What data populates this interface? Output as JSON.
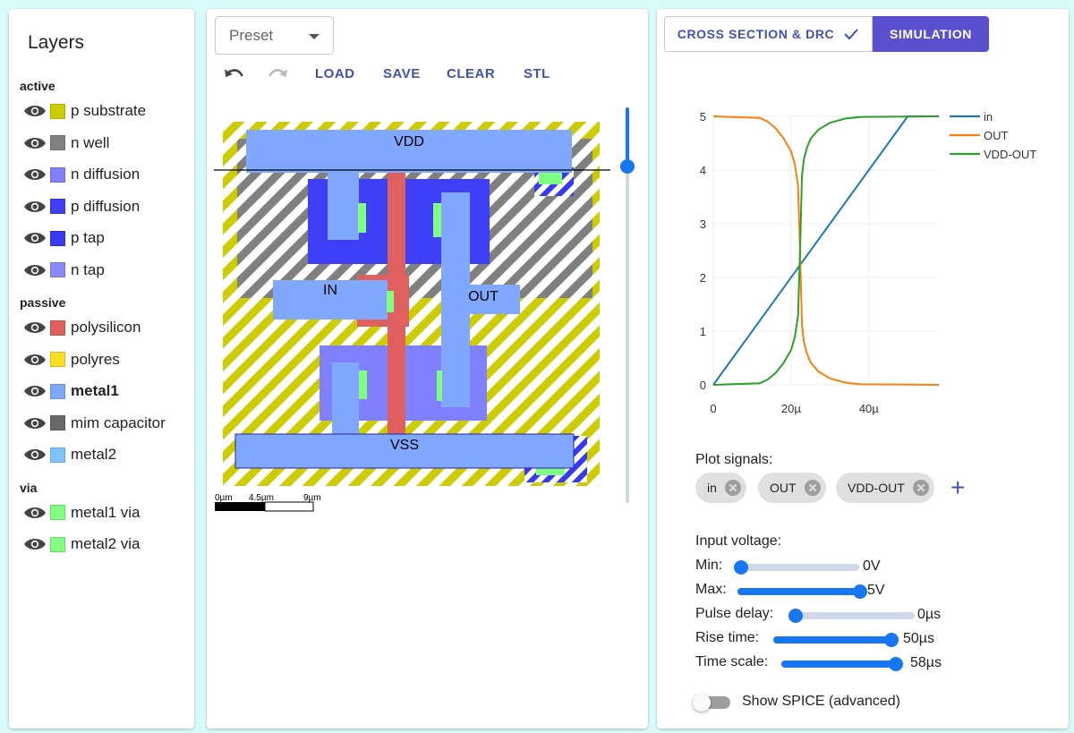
{
  "layers": {
    "title": "Layers",
    "groups": [
      {
        "label": "active",
        "items": [
          {
            "name": "p substrate",
            "color": "#cccc00",
            "bold": false
          },
          {
            "name": "n well",
            "color": "#808080",
            "bold": false
          },
          {
            "name": "n diffusion",
            "color": "#8080ff",
            "bold": false
          },
          {
            "name": "p diffusion",
            "color": "#3f3ff8",
            "bold": false
          },
          {
            "name": "p tap",
            "color": "#3838f0",
            "bold": false
          },
          {
            "name": "n tap",
            "color": "#8888ff",
            "bold": false
          }
        ]
      },
      {
        "label": "passive",
        "items": [
          {
            "name": "polysilicon",
            "color": "#e06060",
            "bold": false
          },
          {
            "name": "polyres",
            "color": "#ffdd22",
            "bold": false
          },
          {
            "name": "metal1",
            "color": "#80a8ff",
            "bold": true
          },
          {
            "name": "mim capacitor",
            "color": "#686868",
            "bold": false
          },
          {
            "name": "metal2",
            "color": "#80c4ff",
            "bold": false
          }
        ]
      },
      {
        "label": "via",
        "items": [
          {
            "name": "metal1 via",
            "color": "#80ff80",
            "bold": false
          },
          {
            "name": "metal2 via",
            "color": "#80ff80",
            "bold": false
          }
        ]
      }
    ]
  },
  "layout": {
    "preset_label": "Preset",
    "toolbar": {
      "load": "LOAD",
      "save": "SAVE",
      "clear": "CLEAR",
      "stl": "STL"
    },
    "net_labels": {
      "vdd": "VDD",
      "vss": "VSS",
      "in": "IN",
      "out": "OUT"
    },
    "scale_labels": [
      "0µm",
      "4.5µm",
      "9µm"
    ]
  },
  "sim": {
    "tab_cross_section": "CROSS SECTION & DRC",
    "tab_simulation": "SIMULATION",
    "plot_signals_label": "Plot signals:",
    "signals": [
      "in",
      "OUT",
      "VDD-OUT"
    ],
    "input_voltage_label": "Input voltage:",
    "sliders": [
      {
        "label": "Min:",
        "value": "0V",
        "fraction": 0.02
      },
      {
        "label": "Max:",
        "value": "5V",
        "fraction": 0.98
      },
      {
        "label": "Pulse delay:",
        "value": "0µs",
        "fraction": 0.02
      },
      {
        "label": "Rise time:",
        "value": "50µs",
        "fraction": 0.98
      },
      {
        "label": "Time scale:",
        "value": "58µs",
        "fraction": 0.98
      }
    ],
    "show_spice_label": "Show SPICE (advanced)"
  },
  "chart_data": {
    "type": "line",
    "x_tick_labels": [
      "0",
      "20µ",
      "40µ"
    ],
    "x_ticks": [
      0,
      20,
      40
    ],
    "y_ticks": [
      0,
      1,
      2,
      3,
      4,
      5
    ],
    "xlim": [
      0,
      58
    ],
    "ylim": [
      0,
      5
    ],
    "legend_position": "top-right",
    "grid": true,
    "series": [
      {
        "name": "in",
        "color": "#1f77b4",
        "x": [
          0,
          50,
          58
        ],
        "y": [
          0,
          5,
          5
        ]
      },
      {
        "name": "OUT",
        "color": "#ff7f0e",
        "x": [
          0,
          12,
          14,
          16,
          18,
          20,
          21,
          21.8,
          22.3,
          22.8,
          23.3,
          24,
          25,
          27,
          30,
          34,
          38,
          58
        ],
        "y": [
          5,
          4.97,
          4.9,
          4.78,
          4.6,
          4.35,
          4.1,
          3.7,
          2.5,
          1.1,
          0.8,
          0.6,
          0.42,
          0.25,
          0.12,
          0.04,
          0.01,
          0
        ]
      },
      {
        "name": "VDD-OUT",
        "color": "#2ca02c",
        "x": [
          0,
          12,
          14,
          16,
          18,
          20,
          21,
          21.8,
          22.3,
          22.8,
          23.3,
          24,
          25,
          27,
          30,
          34,
          38,
          58
        ],
        "y": [
          0,
          0.03,
          0.1,
          0.22,
          0.4,
          0.65,
          0.9,
          1.3,
          2.5,
          3.9,
          4.2,
          4.4,
          4.58,
          4.75,
          4.88,
          4.96,
          4.99,
          5
        ]
      }
    ]
  }
}
